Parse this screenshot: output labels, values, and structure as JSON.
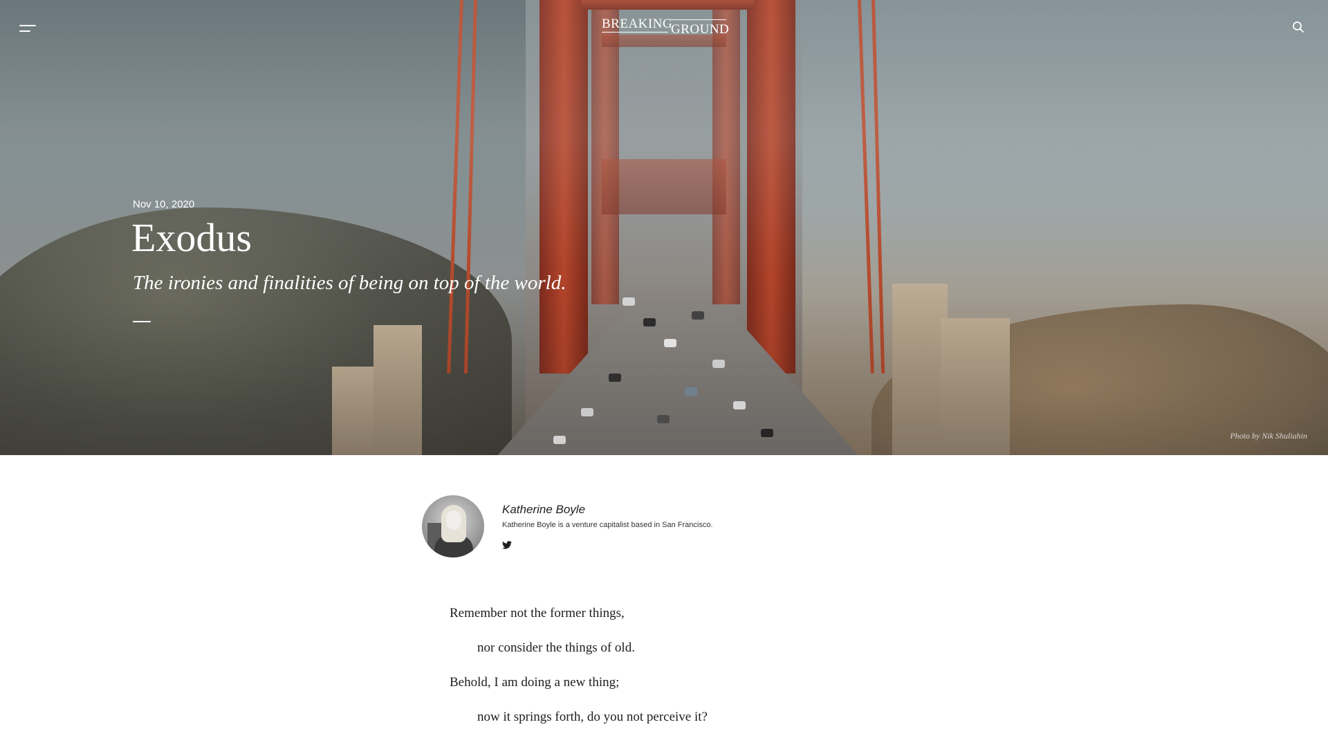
{
  "header": {
    "logo_word_1": "BREAKING",
    "logo_word_2": "GROUND",
    "menu_icon": "hamburger-menu-icon",
    "search_icon": "search-icon"
  },
  "article": {
    "date": "Nov 10, 2020",
    "title": "Exodus",
    "subtitle": "The ironies and finalities of being on top of the world.",
    "photo_credit": "Photo by Nik Shuliahin"
  },
  "author": {
    "name": "Katherine Boyle",
    "bio": "Katherine Boyle is a venture capitalist based in San Francisco.",
    "social_icon": "twitter-icon"
  },
  "poem": {
    "lines": [
      "Remember not the former things,",
      "nor consider the things of old.",
      "Behold, I am doing a new thing;",
      "now it springs forth, do you not perceive it?"
    ]
  },
  "colors": {
    "hero_text": "#ffffff",
    "body_text": "#1e1e1e",
    "bridge_red": "#b4452b"
  }
}
